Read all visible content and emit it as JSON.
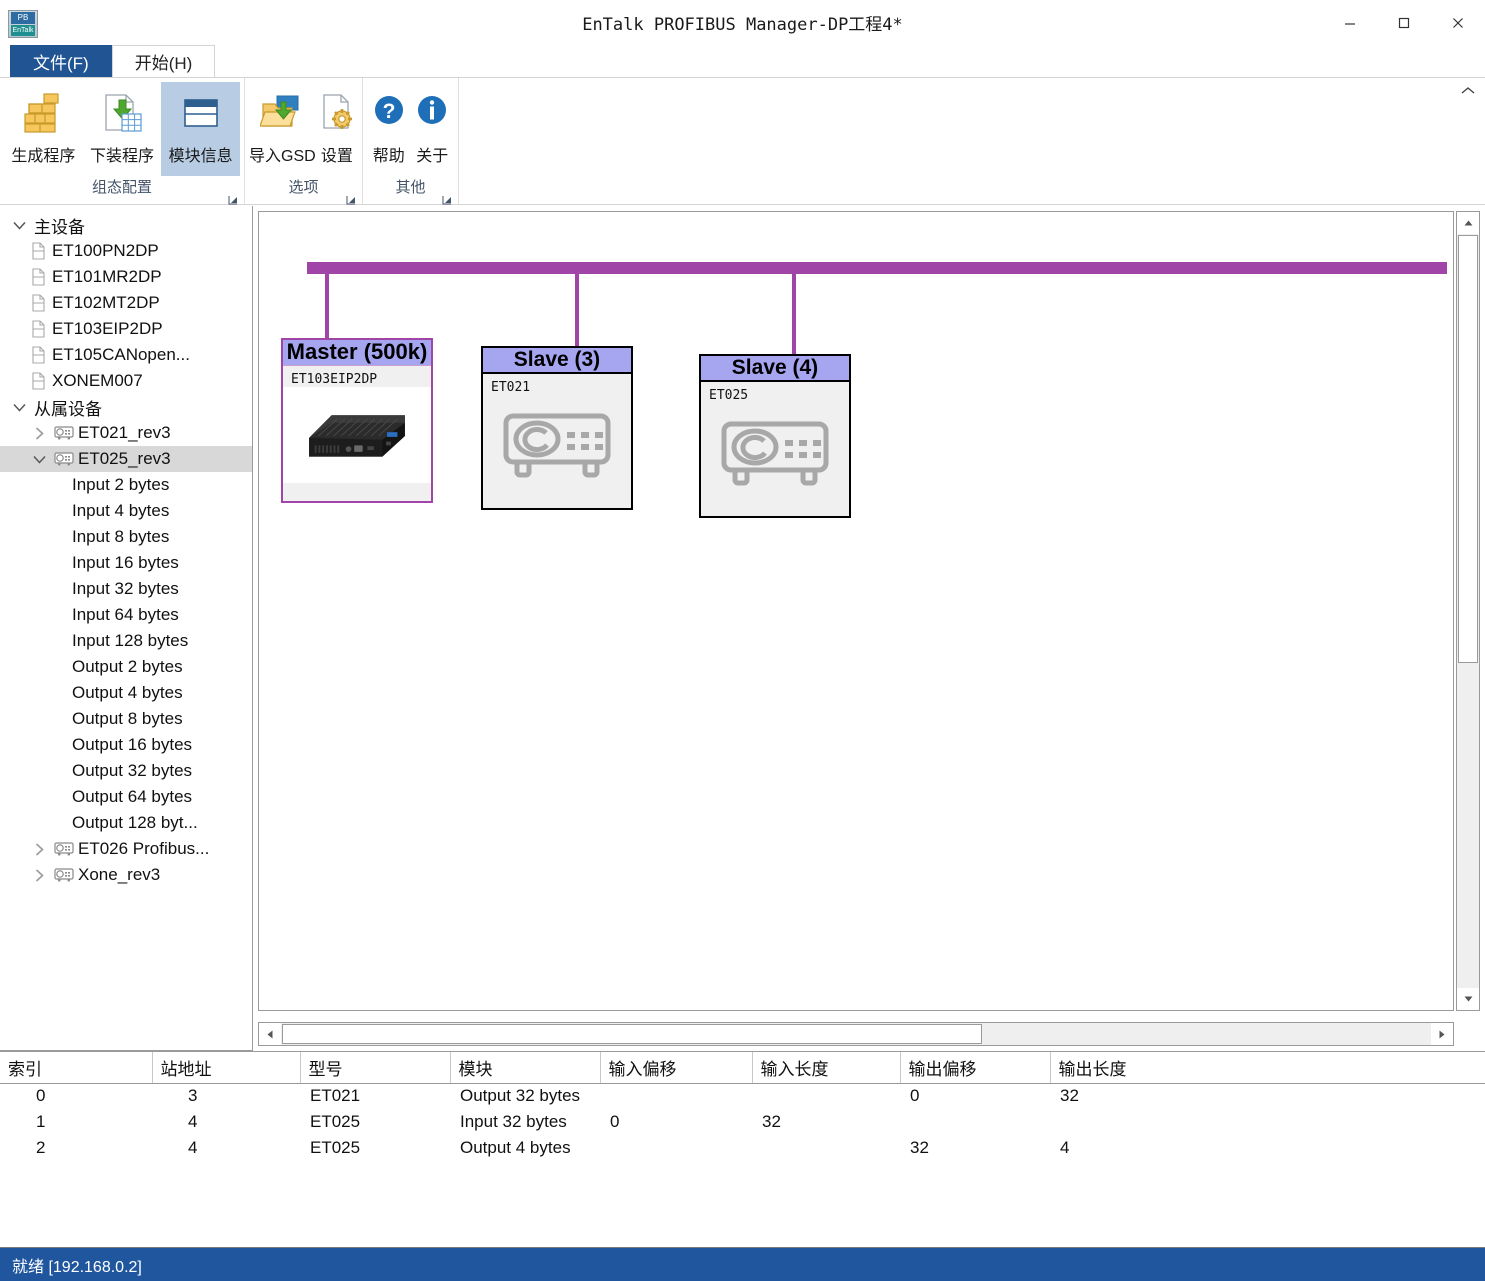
{
  "window": {
    "title": "EnTalk PROFIBUS Manager-DP工程4*",
    "minimize_label": "−",
    "maximize_label": "□",
    "close_label": "✕"
  },
  "ribbon": {
    "tabs": [
      {
        "label": "文件(F)",
        "style": "primary"
      },
      {
        "label": "开始(H)",
        "style": "active"
      }
    ],
    "collapse_label": "⌃",
    "groups": [
      {
        "label": "组态配置",
        "buttons": [
          {
            "label": "生成程序",
            "icon": "bricks-icon",
            "selected": false
          },
          {
            "label": "下装程序",
            "icon": "download-program-icon",
            "selected": false
          },
          {
            "label": "模块信息",
            "icon": "module-info-icon",
            "selected": true
          }
        ]
      },
      {
        "label": "选项",
        "buttons": [
          {
            "label": "导入GSD",
            "icon": "import-folder-icon",
            "selected": false
          },
          {
            "label": "设置",
            "icon": "settings-gear-icon",
            "selected": false
          }
        ]
      },
      {
        "label": "其他",
        "buttons": [
          {
            "label": "帮助",
            "icon": "help-question-icon",
            "selected": false
          },
          {
            "label": "关于",
            "icon": "about-info-icon",
            "selected": false
          }
        ]
      }
    ]
  },
  "tree": [
    {
      "label": "主设备",
      "level": 0,
      "expander": "expanded",
      "icon": "none",
      "selected": false
    },
    {
      "label": "ET100PN2DP",
      "level": 1,
      "expander": "none",
      "icon": "document-icon",
      "selected": false
    },
    {
      "label": "ET101MR2DP",
      "level": 1,
      "expander": "none",
      "icon": "document-icon",
      "selected": false
    },
    {
      "label": "ET102MT2DP",
      "level": 1,
      "expander": "none",
      "icon": "document-icon",
      "selected": false
    },
    {
      "label": "ET103EIP2DP",
      "level": 1,
      "expander": "none",
      "icon": "document-icon",
      "selected": false
    },
    {
      "label": "ET105CANopen...",
      "level": 1,
      "expander": "none",
      "icon": "document-icon",
      "selected": false
    },
    {
      "label": "XONEM007",
      "level": 1,
      "expander": "none",
      "icon": "document-icon",
      "selected": false
    },
    {
      "label": "从属设备",
      "level": 0,
      "expander": "expanded",
      "icon": "none",
      "selected": false
    },
    {
      "label": "ET021_rev3",
      "level": 1,
      "expander": "collapsed",
      "icon": "device-icon",
      "selected": false
    },
    {
      "label": "ET025_rev3",
      "level": 1,
      "expander": "expanded",
      "icon": "device-icon",
      "selected": true
    },
    {
      "label": "Input 2 bytes",
      "level": 2,
      "expander": "none",
      "icon": "none",
      "selected": false
    },
    {
      "label": "Input 4 bytes",
      "level": 2,
      "expander": "none",
      "icon": "none",
      "selected": false
    },
    {
      "label": "Input 8 bytes",
      "level": 2,
      "expander": "none",
      "icon": "none",
      "selected": false
    },
    {
      "label": "Input 16 bytes",
      "level": 2,
      "expander": "none",
      "icon": "none",
      "selected": false
    },
    {
      "label": "Input 32 bytes",
      "level": 2,
      "expander": "none",
      "icon": "none",
      "selected": false
    },
    {
      "label": "Input 64 bytes",
      "level": 2,
      "expander": "none",
      "icon": "none",
      "selected": false
    },
    {
      "label": "Input 128 bytes",
      "level": 2,
      "expander": "none",
      "icon": "none",
      "selected": false
    },
    {
      "label": "Output 2 bytes",
      "level": 2,
      "expander": "none",
      "icon": "none",
      "selected": false
    },
    {
      "label": "Output 4 bytes",
      "level": 2,
      "expander": "none",
      "icon": "none",
      "selected": false
    },
    {
      "label": "Output 8 bytes",
      "level": 2,
      "expander": "none",
      "icon": "none",
      "selected": false
    },
    {
      "label": "Output 16 bytes",
      "level": 2,
      "expander": "none",
      "icon": "none",
      "selected": false
    },
    {
      "label": "Output 32 bytes",
      "level": 2,
      "expander": "none",
      "icon": "none",
      "selected": false
    },
    {
      "label": "Output 64 bytes",
      "level": 2,
      "expander": "none",
      "icon": "none",
      "selected": false
    },
    {
      "label": "Output 128 byt...",
      "level": 2,
      "expander": "none",
      "icon": "none",
      "selected": false
    },
    {
      "label": "ET026 Profibus...",
      "level": 1,
      "expander": "collapsed",
      "icon": "device-icon",
      "selected": false
    },
    {
      "label": "Xone_rev3",
      "level": 1,
      "expander": "collapsed",
      "icon": "device-icon",
      "selected": false
    }
  ],
  "canvas": {
    "bus_color": "#a044a8",
    "header_color": "#a5a5f0",
    "nodes": [
      {
        "title": "Master (500k)",
        "model": "ET103EIP2DP",
        "kind": "master",
        "icon": "mini-pc-image"
      },
      {
        "title": "Slave (3)",
        "model": "ET021",
        "kind": "slave",
        "icon": "profibus-device-icon"
      },
      {
        "title": "Slave (4)",
        "model": "ET025",
        "kind": "slave",
        "icon": "profibus-device-icon"
      }
    ]
  },
  "table": {
    "columns": [
      "索引",
      "站地址",
      "型号",
      "模块",
      "输入偏移",
      "输入长度",
      "输出偏移",
      "输出长度"
    ],
    "rows": [
      {
        "索引": "0",
        "站地址": "3",
        "型号": "ET021",
        "模块": "Output 32 bytes",
        "输入偏移": "",
        "输入长度": "",
        "输出偏移": "0",
        "输出长度": "32"
      },
      {
        "索引": "1",
        "站地址": "4",
        "型号": "ET025",
        "模块": "Input 32 bytes",
        "输入偏移": "0",
        "输入长度": "32",
        "输出偏移": "",
        "输出长度": ""
      },
      {
        "索引": "2",
        "站地址": "4",
        "型号": "ET025",
        "模块": "Output 4 bytes",
        "输入偏移": "",
        "输入长度": "",
        "输出偏移": "32",
        "输出长度": "4"
      }
    ]
  },
  "statusbar": {
    "text": "就绪 [192.168.0.2]"
  }
}
